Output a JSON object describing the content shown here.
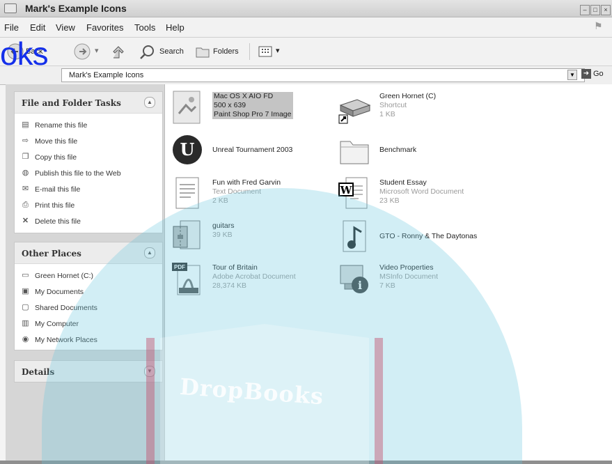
{
  "window": {
    "title": "Mark's Example Icons",
    "buttons": [
      "–",
      "□",
      "×"
    ]
  },
  "menu": [
    "File",
    "Edit",
    "View",
    "Favorites",
    "Tools",
    "Help"
  ],
  "toolbar": {
    "back": "Back",
    "search": "Search",
    "folders": "Folders"
  },
  "address": {
    "path": "Mark's Example Icons",
    "go": "Go"
  },
  "tasks_panel": {
    "title": "File and Folder Tasks",
    "items": [
      {
        "icon": "rename-icon",
        "label": "Rename this file"
      },
      {
        "icon": "move-icon",
        "label": "Move this file"
      },
      {
        "icon": "copy-icon",
        "label": "Copy this file"
      },
      {
        "icon": "publish-web-icon",
        "label": "Publish this file to the Web"
      },
      {
        "icon": "email-icon",
        "label": "E-mail this file"
      },
      {
        "icon": "print-icon",
        "label": "Print this file"
      },
      {
        "icon": "delete-icon",
        "label": "Delete this file"
      }
    ]
  },
  "places_panel": {
    "title": "Other Places",
    "items": [
      {
        "icon": "drive-icon",
        "label": "Green Hornet (C:)"
      },
      {
        "icon": "my-documents-icon",
        "label": "My Documents"
      },
      {
        "icon": "shared-documents-icon",
        "label": "Shared Documents"
      },
      {
        "icon": "my-computer-icon",
        "label": "My Computer"
      },
      {
        "icon": "network-places-icon",
        "label": "My Network Places"
      }
    ]
  },
  "details_panel": {
    "title": "Details"
  },
  "files": [
    {
      "icon": "image-file-icon",
      "name": "Mac OS X AIO FD",
      "line2": "500 x 639",
      "line3": "Paint Shop Pro 7 Image",
      "selected": true
    },
    {
      "icon": "drive-shortcut-icon",
      "name": "Green Hornet (C)",
      "line2": "Shortcut",
      "line3": "1 KB"
    },
    {
      "icon": "unreal-tournament-icon",
      "name": "Unreal Tournament 2003",
      "line2": "",
      "line3": ""
    },
    {
      "icon": "folder-icon",
      "name": "Benchmark",
      "line2": "",
      "line3": ""
    },
    {
      "icon": "text-document-icon",
      "name": "Fun with Fred Garvin",
      "line2": "Text Document",
      "line3": "2 KB"
    },
    {
      "icon": "word-document-icon",
      "name": "Student Essay",
      "line2": "Microsoft Word Document",
      "line3": "23 KB"
    },
    {
      "icon": "archive-file-icon",
      "name": "guitars",
      "line2": "39 KB",
      "line3": ""
    },
    {
      "icon": "music-file-icon",
      "name": "GTO - Ronny & The Daytonas",
      "line2": "",
      "line3": ""
    },
    {
      "icon": "pdf-file-icon",
      "name": "Tour of Britain",
      "line2": "Adobe Acrobat Document",
      "line3": "28,374 KB"
    },
    {
      "icon": "msinfo-file-icon",
      "name": "Video Properties",
      "line2": "MSInfo Document",
      "line3": "7 KB"
    }
  ],
  "watermark": {
    "logo_text": "oks",
    "book_text": "DropBooks"
  }
}
